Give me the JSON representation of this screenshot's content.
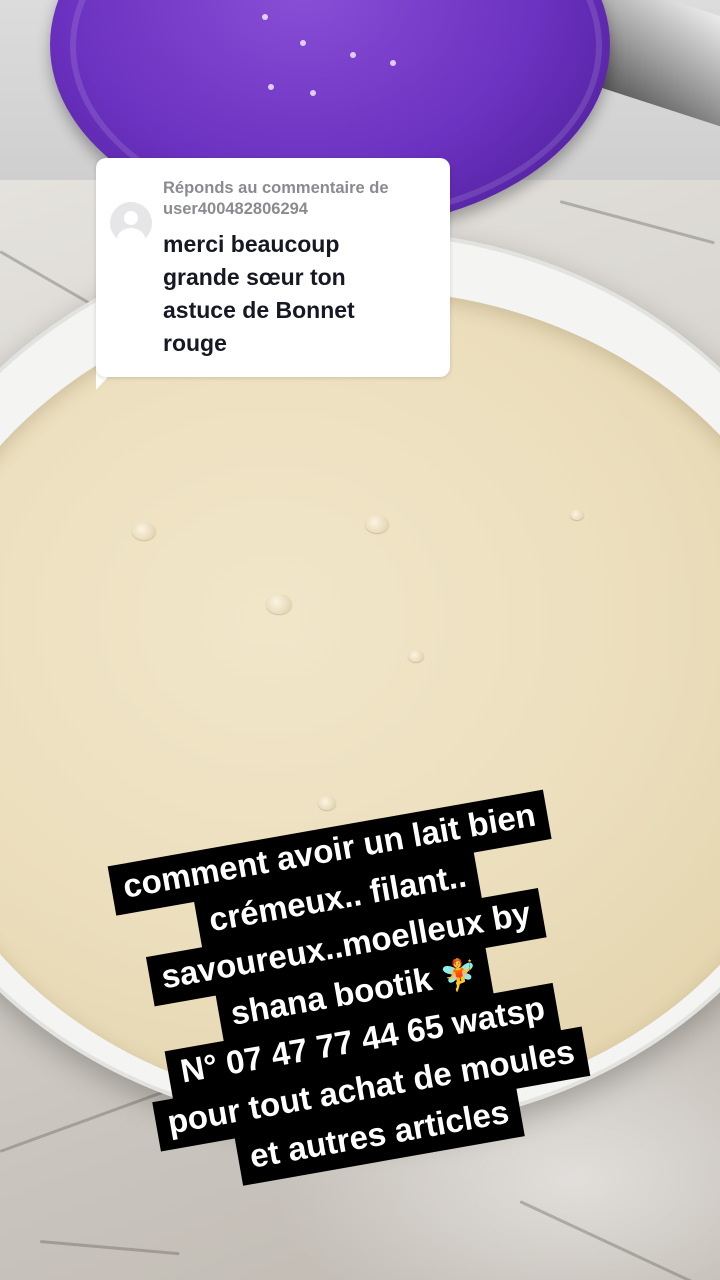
{
  "reply": {
    "meta": "Réponds au commentaire de user400482806294",
    "text_lines": [
      "merci beaucoup",
      "grande sœur ton",
      "astuce de Bonnet",
      "rouge"
    ]
  },
  "caption": {
    "lines": [
      "comment avoir un lait bien",
      "crémeux.. filant..",
      "savoureux..moelleux by",
      "shana bootik",
      "N° 07 47 77 44 65 watsp",
      "pour tout achat de moules",
      "et autres articles"
    ],
    "emoji": "🧚"
  },
  "colors": {
    "lid": "#6b31c0",
    "cream": "#ecdfbe",
    "caption_bg": "#000000",
    "caption_text": "#ffffff"
  }
}
